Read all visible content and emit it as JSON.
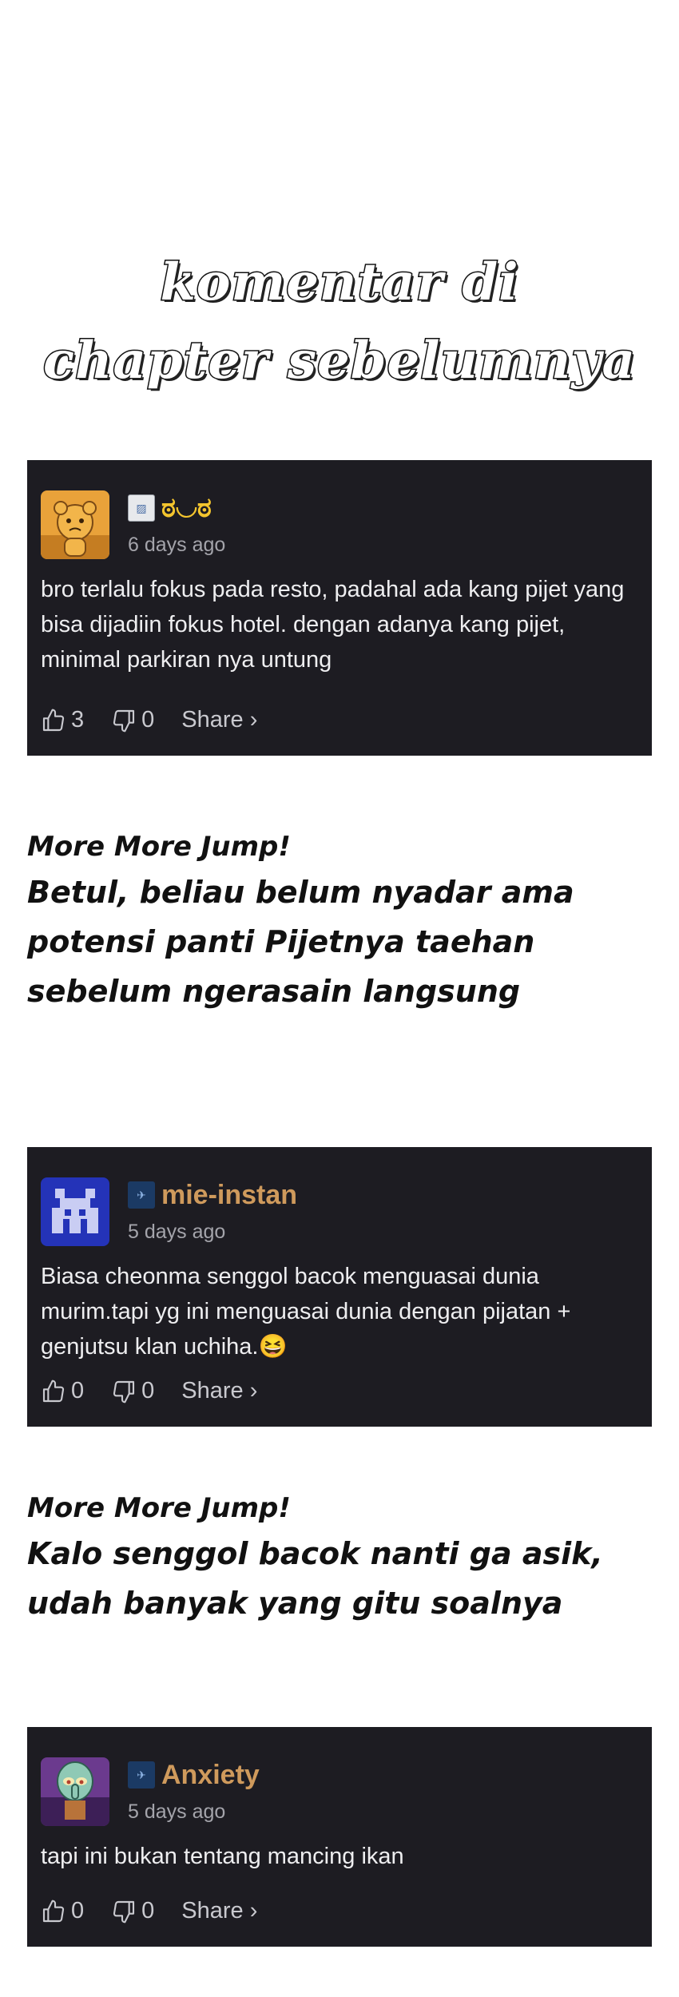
{
  "heading": {
    "line1": "komentar di",
    "line2": "chapter sebelumnya"
  },
  "comments": [
    {
      "username": "ಠ◡ಠ",
      "time": "6 days ago",
      "text": "bro terlalu fokus pada resto, padahal ada kang pijet yang bisa dijadiin fokus hotel. dengan adanya kang pijet, minimal parkiran nya untung",
      "likes": "3",
      "dislikes": "0",
      "share_label": "Share ›",
      "avatar_icon": "cartoon-bear-avatar-icon",
      "username_color": "#f4c52e"
    },
    {
      "username": "mie-instan",
      "time": "5 days ago",
      "text": "Biasa cheonma senggol bacok menguasai dunia murim.tapi yg ini menguasai dunia dengan pijatan + genjutsu klan uchiha.😆",
      "likes": "0",
      "dislikes": "0",
      "share_label": "Share ›",
      "avatar_icon": "pixel-invader-avatar-icon",
      "username_color": "#cf9a5c"
    },
    {
      "username": "Anxiety",
      "time": "5 days ago",
      "text": "tapi ini bukan tentang mancing ikan",
      "likes": "0",
      "dislikes": "0",
      "share_label": "Share ›",
      "avatar_icon": "squidward-avatar-icon",
      "username_color": "#cf9a5c"
    }
  ],
  "replies": [
    {
      "name": "More More Jump!",
      "text": "Betul, beliau belum nyadar ama potensi panti Pijetnya taehan sebelum ngerasain langsung"
    },
    {
      "name": "More More Jump!",
      "text": "Kalo senggol bacok nanti ga asik, udah banyak yang gitu soalnya"
    }
  ]
}
